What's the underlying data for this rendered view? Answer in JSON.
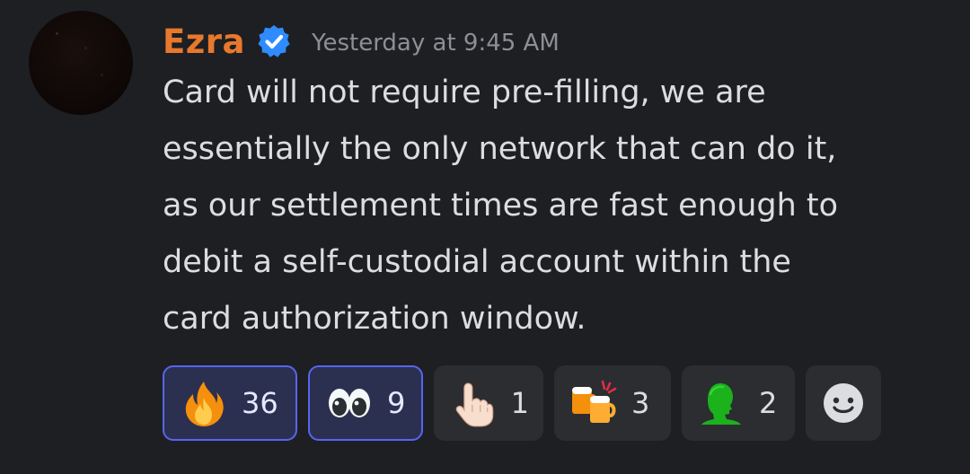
{
  "message": {
    "author": {
      "name": "Ezra",
      "name_color": "#e8782d",
      "verified": true,
      "verified_icon": "verified-badge-icon"
    },
    "timestamp": "Yesterday at 9:45 AM",
    "content_lines": [
      "Card will not require pre-filling, we are",
      "essentially the only network that can do it,",
      "as our settlement times are fast enough to",
      "debit a self-custodial account within the",
      "card authorization window."
    ]
  },
  "reactions": [
    {
      "emoji": "fire",
      "count": "36",
      "selected": true
    },
    {
      "emoji": "eyes",
      "count": "9",
      "selected": true
    },
    {
      "emoji": "point-up-light-skin",
      "count": "1",
      "selected": false
    },
    {
      "emoji": "clinking-beer-mugs",
      "count": "3",
      "selected": false
    },
    {
      "emoji": "green-bust-silhouette",
      "count": "2",
      "selected": false
    }
  ],
  "add_reaction_icon": "add-reaction-smiley-icon",
  "colors": {
    "background": "#1e1f22",
    "reaction_bg": "#2b2d31",
    "reaction_selected_bg": "#2c3050",
    "reaction_selected_border": "#5865f2",
    "text": "#dbdde1",
    "timestamp": "#8d8f96"
  }
}
